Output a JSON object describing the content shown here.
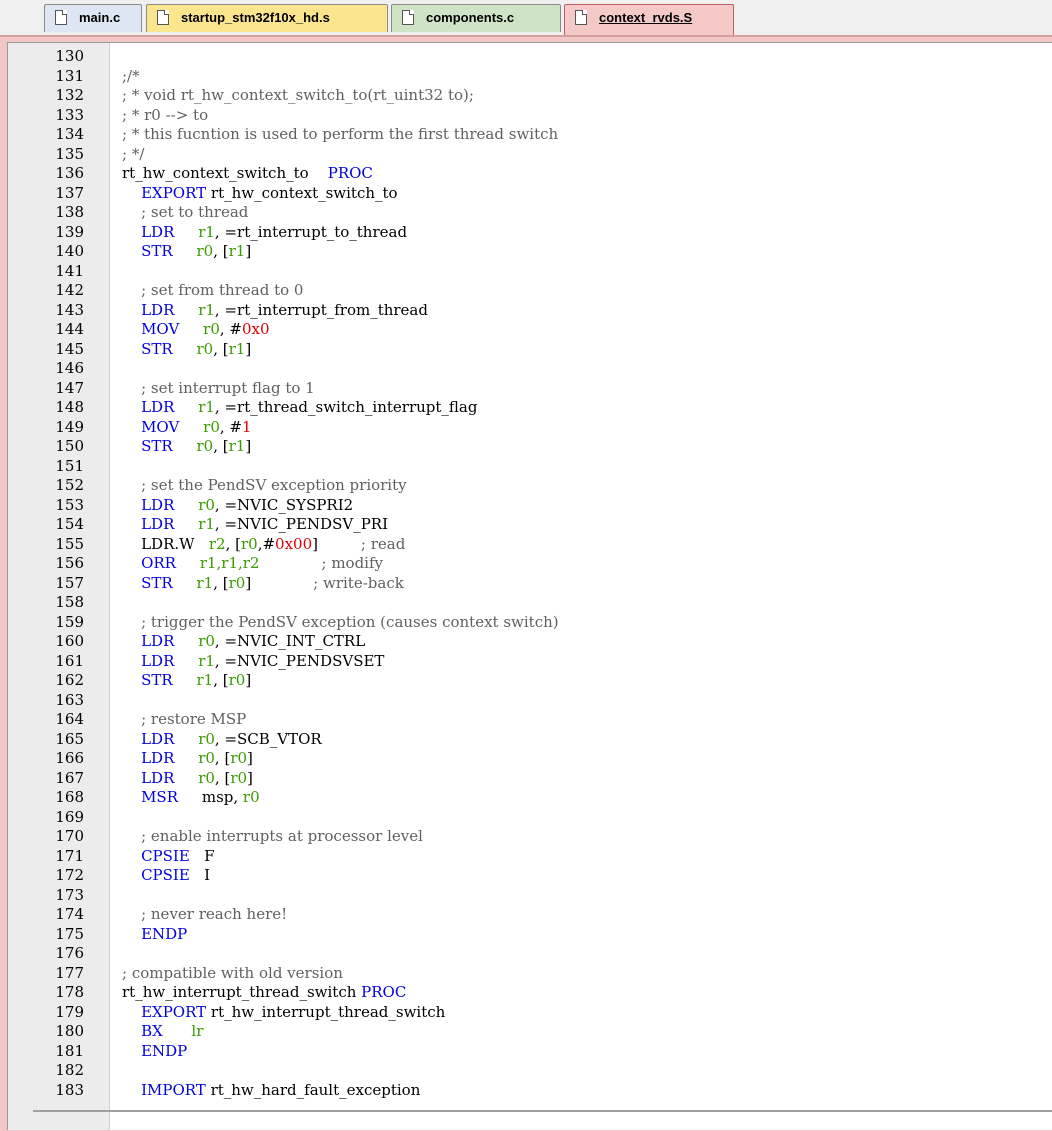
{
  "tabs": [
    {
      "label": "main.c"
    },
    {
      "label": "startup_stm32f10x_hd.s"
    },
    {
      "label": "components.c"
    },
    {
      "label": "context_rvds.S"
    }
  ],
  "code_lines": [
    {
      "n": "130",
      "parts": []
    },
    {
      "n": "131",
      "parts": [
        [
          "cm",
          ";/*"
        ]
      ]
    },
    {
      "n": "132",
      "parts": [
        [
          "cm",
          "; * void rt_hw_context_switch_to(rt_uint32 to);"
        ]
      ]
    },
    {
      "n": "133",
      "parts": [
        [
          "cm",
          "; * r0 --> to"
        ]
      ]
    },
    {
      "n": "134",
      "parts": [
        [
          "cm",
          "; * this fucntion is used to perform the first thread switch"
        ]
      ]
    },
    {
      "n": "135",
      "parts": [
        [
          "cm",
          "; */"
        ]
      ]
    },
    {
      "n": "136",
      "parts": [
        [
          "",
          "rt_hw_context_switch_to    "
        ],
        [
          "kw",
          "PROC"
        ]
      ]
    },
    {
      "n": "137",
      "parts": [
        [
          "",
          "    "
        ],
        [
          "kw",
          "EXPORT"
        ],
        [
          "",
          " rt_hw_context_switch_to"
        ]
      ]
    },
    {
      "n": "138",
      "parts": [
        [
          "",
          "    "
        ],
        [
          "cm",
          "; set to thread"
        ]
      ]
    },
    {
      "n": "139",
      "parts": [
        [
          "",
          "    "
        ],
        [
          "kw",
          "LDR"
        ],
        [
          "",
          "     "
        ],
        [
          "rg",
          "r1"
        ],
        [
          "",
          ", =rt_interrupt_to_thread"
        ]
      ]
    },
    {
      "n": "140",
      "parts": [
        [
          "",
          "    "
        ],
        [
          "kw",
          "STR"
        ],
        [
          "",
          "     "
        ],
        [
          "rg",
          "r0"
        ],
        [
          "",
          ", ["
        ],
        [
          "rg",
          "r1"
        ],
        [
          "",
          "]"
        ]
      ]
    },
    {
      "n": "141",
      "parts": []
    },
    {
      "n": "142",
      "parts": [
        [
          "",
          "    "
        ],
        [
          "cm",
          "; set from thread to 0"
        ]
      ]
    },
    {
      "n": "143",
      "parts": [
        [
          "",
          "    "
        ],
        [
          "kw",
          "LDR"
        ],
        [
          "",
          "     "
        ],
        [
          "rg",
          "r1"
        ],
        [
          "",
          ", =rt_interrupt_from_thread"
        ]
      ]
    },
    {
      "n": "144",
      "parts": [
        [
          "",
          "    "
        ],
        [
          "kw",
          "MOV"
        ],
        [
          "",
          "     "
        ],
        [
          "rg",
          "r0"
        ],
        [
          "",
          ", #"
        ],
        [
          "nm",
          "0x0"
        ]
      ]
    },
    {
      "n": "145",
      "parts": [
        [
          "",
          "    "
        ],
        [
          "kw",
          "STR"
        ],
        [
          "",
          "     "
        ],
        [
          "rg",
          "r0"
        ],
        [
          "",
          ", ["
        ],
        [
          "rg",
          "r1"
        ],
        [
          "",
          "]"
        ]
      ]
    },
    {
      "n": "146",
      "parts": []
    },
    {
      "n": "147",
      "parts": [
        [
          "",
          "    "
        ],
        [
          "cm",
          "; set interrupt flag to 1"
        ]
      ]
    },
    {
      "n": "148",
      "parts": [
        [
          "",
          "    "
        ],
        [
          "kw",
          "LDR"
        ],
        [
          "",
          "     "
        ],
        [
          "rg",
          "r1"
        ],
        [
          "",
          ", =rt_thread_switch_interrupt_flag"
        ]
      ]
    },
    {
      "n": "149",
      "parts": [
        [
          "",
          "    "
        ],
        [
          "kw",
          "MOV"
        ],
        [
          "",
          "     "
        ],
        [
          "rg",
          "r0"
        ],
        [
          "",
          ", #"
        ],
        [
          "nm",
          "1"
        ]
      ]
    },
    {
      "n": "150",
      "parts": [
        [
          "",
          "    "
        ],
        [
          "kw",
          "STR"
        ],
        [
          "",
          "     "
        ],
        [
          "rg",
          "r0"
        ],
        [
          "",
          ", ["
        ],
        [
          "rg",
          "r1"
        ],
        [
          "",
          "]"
        ]
      ]
    },
    {
      "n": "151",
      "parts": []
    },
    {
      "n": "152",
      "parts": [
        [
          "",
          "    "
        ],
        [
          "cm",
          "; set the PendSV exception priority"
        ]
      ]
    },
    {
      "n": "153",
      "parts": [
        [
          "",
          "    "
        ],
        [
          "kw",
          "LDR"
        ],
        [
          "",
          "     "
        ],
        [
          "rg",
          "r0"
        ],
        [
          "",
          ", =NVIC_SYSPRI2"
        ]
      ]
    },
    {
      "n": "154",
      "parts": [
        [
          "",
          "    "
        ],
        [
          "kw",
          "LDR"
        ],
        [
          "",
          "     "
        ],
        [
          "rg",
          "r1"
        ],
        [
          "",
          ", =NVIC_PENDSV_PRI"
        ]
      ]
    },
    {
      "n": "155",
      "parts": [
        [
          "",
          "    "
        ],
        [
          "",
          "LDR.W"
        ],
        [
          "",
          "   "
        ],
        [
          "rg",
          "r2"
        ],
        [
          "",
          ", ["
        ],
        [
          "rg",
          "r0"
        ],
        [
          "",
          ",#"
        ],
        [
          "nm",
          "0x00"
        ],
        [
          "",
          "]         "
        ],
        [
          "cm",
          "; read"
        ]
      ]
    },
    {
      "n": "156",
      "parts": [
        [
          "",
          "    "
        ],
        [
          "kw",
          "ORR"
        ],
        [
          "",
          "     "
        ],
        [
          "rg",
          "r1,r1,r2"
        ],
        [
          "",
          "             "
        ],
        [
          "cm",
          "; modify"
        ]
      ]
    },
    {
      "n": "157",
      "parts": [
        [
          "",
          "    "
        ],
        [
          "kw",
          "STR"
        ],
        [
          "",
          "     "
        ],
        [
          "rg",
          "r1"
        ],
        [
          "",
          ", ["
        ],
        [
          "rg",
          "r0"
        ],
        [
          "",
          "]             "
        ],
        [
          "cm",
          "; write-back"
        ]
      ]
    },
    {
      "n": "158",
      "parts": []
    },
    {
      "n": "159",
      "parts": [
        [
          "",
          "    "
        ],
        [
          "cm",
          "; trigger the PendSV exception (causes context switch)"
        ]
      ]
    },
    {
      "n": "160",
      "parts": [
        [
          "",
          "    "
        ],
        [
          "kw",
          "LDR"
        ],
        [
          "",
          "     "
        ],
        [
          "rg",
          "r0"
        ],
        [
          "",
          ", =NVIC_INT_CTRL"
        ]
      ]
    },
    {
      "n": "161",
      "parts": [
        [
          "",
          "    "
        ],
        [
          "kw",
          "LDR"
        ],
        [
          "",
          "     "
        ],
        [
          "rg",
          "r1"
        ],
        [
          "",
          ", =NVIC_PENDSVSET"
        ]
      ]
    },
    {
      "n": "162",
      "parts": [
        [
          "",
          "    "
        ],
        [
          "kw",
          "STR"
        ],
        [
          "",
          "     "
        ],
        [
          "rg",
          "r1"
        ],
        [
          "",
          ", ["
        ],
        [
          "rg",
          "r0"
        ],
        [
          "",
          "]"
        ]
      ]
    },
    {
      "n": "163",
      "parts": []
    },
    {
      "n": "164",
      "parts": [
        [
          "",
          "    "
        ],
        [
          "cm",
          "; restore MSP"
        ]
      ]
    },
    {
      "n": "165",
      "parts": [
        [
          "",
          "    "
        ],
        [
          "kw",
          "LDR"
        ],
        [
          "",
          "     "
        ],
        [
          "rg",
          "r0"
        ],
        [
          "",
          ", =SCB_VTOR"
        ]
      ]
    },
    {
      "n": "166",
      "parts": [
        [
          "",
          "    "
        ],
        [
          "kw",
          "LDR"
        ],
        [
          "",
          "     "
        ],
        [
          "rg",
          "r0"
        ],
        [
          "",
          ", ["
        ],
        [
          "rg",
          "r0"
        ],
        [
          "",
          "]"
        ]
      ]
    },
    {
      "n": "167",
      "parts": [
        [
          "",
          "    "
        ],
        [
          "kw",
          "LDR"
        ],
        [
          "",
          "     "
        ],
        [
          "rg",
          "r0"
        ],
        [
          "",
          ", ["
        ],
        [
          "rg",
          "r0"
        ],
        [
          "",
          "]"
        ]
      ]
    },
    {
      "n": "168",
      "parts": [
        [
          "",
          "    "
        ],
        [
          "kw",
          "MSR"
        ],
        [
          "",
          "     msp, "
        ],
        [
          "rg",
          "r0"
        ]
      ]
    },
    {
      "n": "169",
      "parts": []
    },
    {
      "n": "170",
      "parts": [
        [
          "",
          "    "
        ],
        [
          "cm",
          "; enable interrupts at processor level"
        ]
      ]
    },
    {
      "n": "171",
      "parts": [
        [
          "",
          "    "
        ],
        [
          "kw",
          "CPSIE"
        ],
        [
          "",
          "   F"
        ]
      ]
    },
    {
      "n": "172",
      "parts": [
        [
          "",
          "    "
        ],
        [
          "kw",
          "CPSIE"
        ],
        [
          "",
          "   I"
        ]
      ]
    },
    {
      "n": "173",
      "parts": []
    },
    {
      "n": "174",
      "parts": [
        [
          "",
          "    "
        ],
        [
          "cm",
          "; never reach here!"
        ]
      ]
    },
    {
      "n": "175",
      "parts": [
        [
          "",
          "    "
        ],
        [
          "kw",
          "ENDP"
        ]
      ]
    },
    {
      "n": "176",
      "parts": []
    },
    {
      "n": "177",
      "parts": [
        [
          "cm",
          "; compatible with old version"
        ]
      ]
    },
    {
      "n": "178",
      "parts": [
        [
          "",
          "rt_hw_interrupt_thread_switch "
        ],
        [
          "kw",
          "PROC"
        ]
      ]
    },
    {
      "n": "179",
      "parts": [
        [
          "",
          "    "
        ],
        [
          "kw",
          "EXPORT"
        ],
        [
          "",
          " rt_hw_interrupt_thread_switch"
        ]
      ]
    },
    {
      "n": "180",
      "parts": [
        [
          "",
          "    "
        ],
        [
          "kw",
          "BX"
        ],
        [
          "",
          "      "
        ],
        [
          "rg",
          "lr"
        ]
      ]
    },
    {
      "n": "181",
      "parts": [
        [
          "",
          "    "
        ],
        [
          "kw",
          "ENDP"
        ]
      ]
    },
    {
      "n": "182",
      "parts": []
    },
    {
      "n": "183",
      "parts": [
        [
          "",
          "    "
        ],
        [
          "kw",
          "IMPORT"
        ],
        [
          "",
          " rt_hw_hard_fault_exception"
        ]
      ]
    }
  ]
}
